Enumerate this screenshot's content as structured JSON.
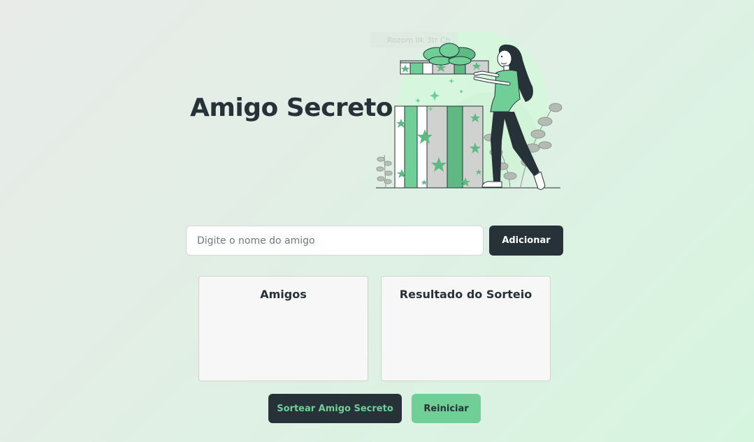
{
  "header": {
    "title": "Amigo Secreto",
    "illustration_icon": "woman-holding-gift-illustration"
  },
  "add_friend": {
    "input_value": "",
    "input_placeholder": "Digite o nome do amigo",
    "add_button_label": "Adicionar"
  },
  "friends_panel": {
    "title": "Amigos",
    "items": []
  },
  "result_panel": {
    "title": "Resultado do Sorteio",
    "items": []
  },
  "actions": {
    "draw_label": "Sortear Amigo Secreto",
    "reset_label": "Reiniciar"
  },
  "colors": {
    "dark": "#263238",
    "accent_green": "#6fcf97",
    "dark_green": "#5fb982",
    "card_bg": "#f7f7f7"
  }
}
